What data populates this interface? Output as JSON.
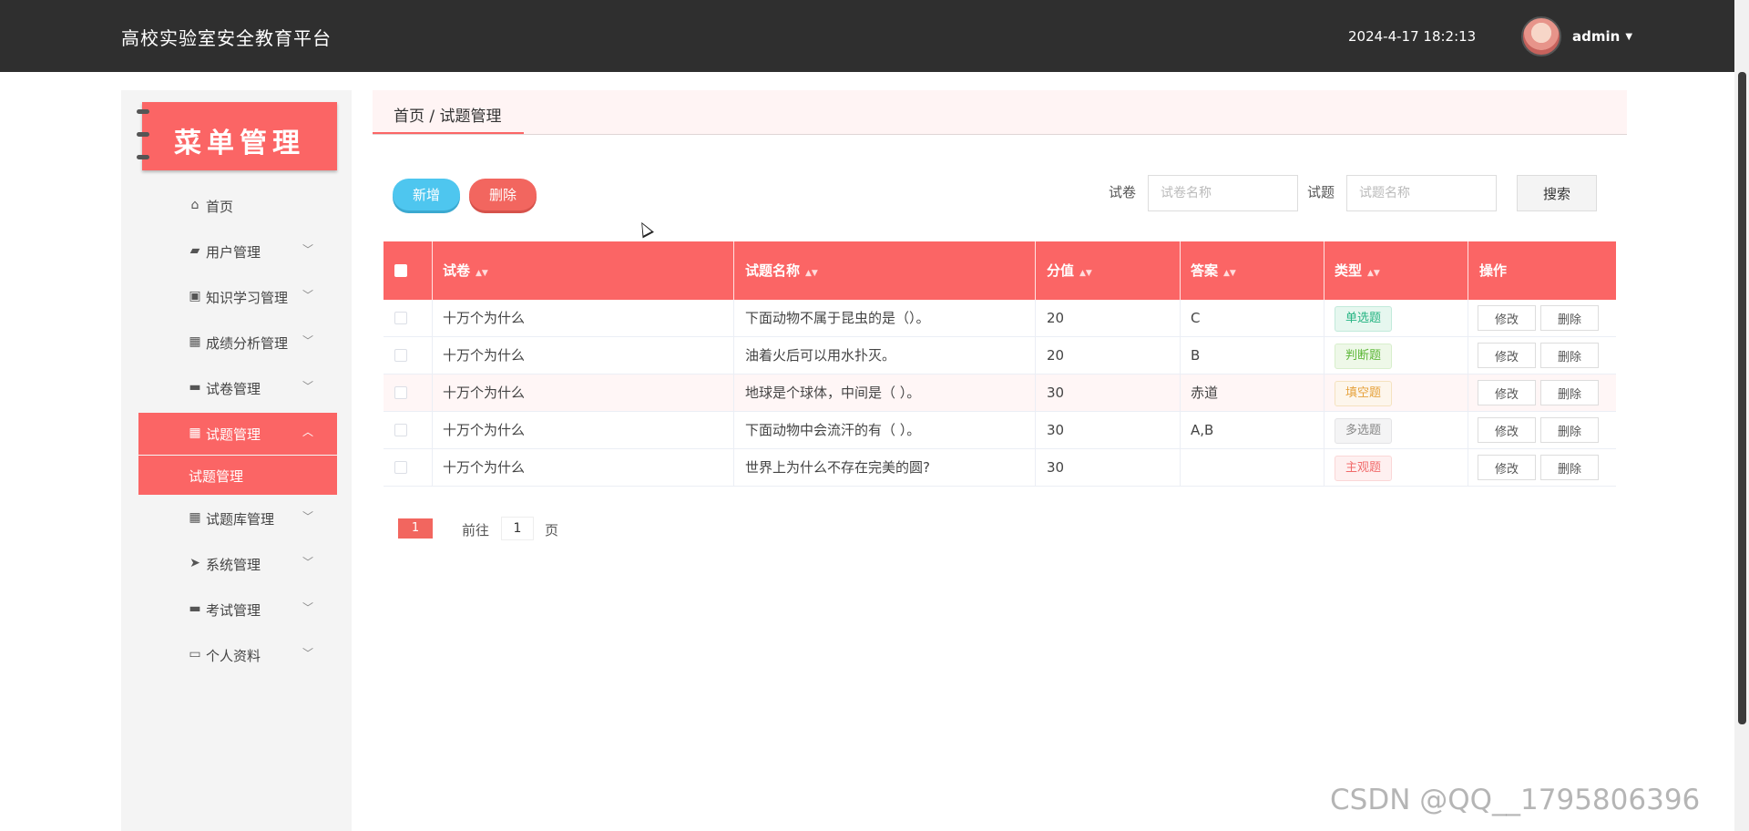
{
  "header": {
    "title": "高校实验室安全教育平台",
    "datetime": "2024-4-17 18:2:13",
    "username": "admin"
  },
  "sidebar": {
    "logo_text": "菜单管理",
    "items": [
      {
        "label": "首页",
        "icon": "home-icon"
      },
      {
        "label": "用户管理",
        "icon": "user-icon"
      },
      {
        "label": "知识学习管理",
        "icon": "clipboard-icon"
      },
      {
        "label": "成绩分析管理",
        "icon": "grid-icon"
      },
      {
        "label": "试卷管理",
        "icon": "monitor-icon"
      },
      {
        "label": "试题管理",
        "icon": "grid-icon"
      },
      {
        "label": "试题库管理",
        "icon": "grid-icon"
      },
      {
        "label": "系统管理",
        "icon": "send-icon"
      },
      {
        "label": "考试管理",
        "icon": "monitor-icon"
      },
      {
        "label": "个人资料",
        "icon": "card-icon"
      }
    ],
    "active_sub": "试题管理"
  },
  "breadcrumb": "首页 / 试题管理",
  "toolbar": {
    "add_label": "新增",
    "delete_label": "删除",
    "paper_label": "试卷",
    "paper_placeholder": "试卷名称",
    "question_label": "试题",
    "question_placeholder": "试题名称",
    "search_label": "搜索"
  },
  "table": {
    "columns": [
      "试卷",
      "试题名称",
      "分值",
      "答案",
      "类型",
      "操作"
    ],
    "rows": [
      {
        "paper": "十万个为什么",
        "question": "下面动物不属于昆虫的是（）。",
        "score": "20",
        "answer": "C",
        "type": "单选题",
        "type_color": "green"
      },
      {
        "paper": "十万个为什么",
        "question": "油着火后可以用水扑灭。",
        "score": "20",
        "answer": "B",
        "type": "判断题",
        "type_color": "lgreen"
      },
      {
        "paper": "十万个为什么",
        "question": "地球是个球体，中间是（ ）。",
        "score": "30",
        "answer": "赤道",
        "type": "填空题",
        "type_color": "orange"
      },
      {
        "paper": "十万个为什么",
        "question": "下面动物中会流汗的有（ ）。",
        "score": "30",
        "answer": "A,B",
        "type": "多选题",
        "type_color": "gray"
      },
      {
        "paper": "十万个为什么",
        "question": "世界上为什么不存在完美的圆?",
        "score": "30",
        "answer": "",
        "type": "主观题",
        "type_color": "red"
      }
    ],
    "edit_label": "修改",
    "delete_label": "删除"
  },
  "pagination": {
    "current": "1",
    "goto_label": "前往",
    "goto_value": "1",
    "page_suffix": "页"
  },
  "watermark": "CSDN @QQ__1795806396",
  "colors": {
    "header_bg": "#2f2f2f",
    "accent": "#fb6565",
    "add_button": "#4ec6ef"
  }
}
